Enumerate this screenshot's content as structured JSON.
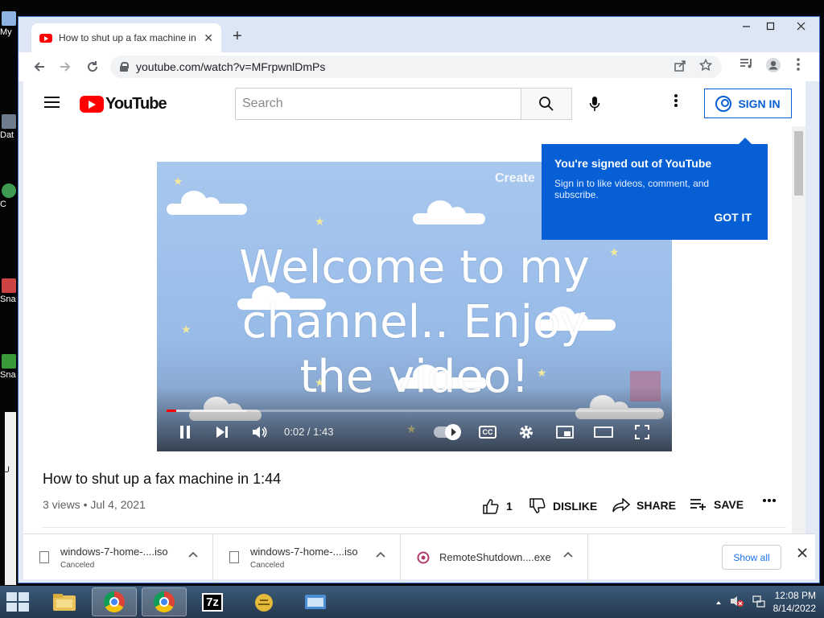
{
  "browser": {
    "tab_title": "How to shut up a fax machine in 1:44",
    "tab_close": "✕",
    "new_tab": "+",
    "url": "youtube.com/watch?v=MFrpwnlDmPs"
  },
  "youtube": {
    "logo_text": "YouTube",
    "search_placeholder": "Search",
    "sign_in": "SIGN IN",
    "tooltip": {
      "title": "You're signed out of YouTube",
      "body": "Sign in to like videos, comment, and subscribe.",
      "button": "GOT IT"
    },
    "video": {
      "overlay_line1": "Welcome to my",
      "overlay_line2": "channel.. Enjoy",
      "overlay_line3": "the video!",
      "watermark": "Create",
      "time": "0:02 / 1:43",
      "played_fraction": 0.02,
      "buffered_fraction": 0.16,
      "cc": "CC"
    },
    "title": "How to shut up a fax machine in 1:44",
    "meta": "3 views • Jul 4, 2021",
    "likes": "1",
    "dislike": "DISLIKE",
    "share": "SHARE",
    "save": "SAVE"
  },
  "downloads": [
    {
      "name": "windows-7-home-....iso",
      "status": "Canceled"
    },
    {
      "name": "windows-7-home-....iso",
      "status": "Canceled"
    },
    {
      "name": "RemoteShutdown....exe",
      "status": ""
    }
  ],
  "downloads_show_all": "Show all",
  "taskbar": {
    "time": "12:08 PM",
    "date": "8/14/2022",
    "sevenzip": "7z"
  },
  "desktop_labels": [
    "My",
    "Dat",
    "C",
    "Sna\nV",
    "Sna",
    "U"
  ],
  "colors": {
    "yt_red": "#ff0000",
    "yt_blue": "#065fd4",
    "taskbar": "#2b4260"
  }
}
